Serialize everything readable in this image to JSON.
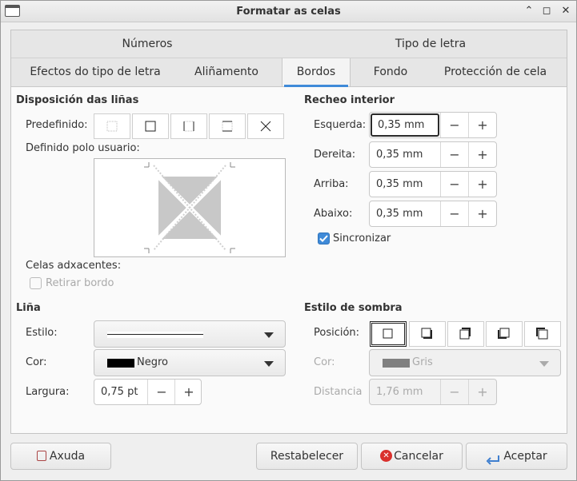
{
  "window": {
    "title": "Formatar as celas"
  },
  "tabs_row1": [
    "Números",
    "Tipo de letra"
  ],
  "tabs_row2": [
    "Efectos do tipo de letra",
    "Aliñamento",
    "Bordos",
    "Fondo",
    "Protección de cela"
  ],
  "active_tab": "Bordos",
  "line_arrangement": {
    "title": "Disposición das liñas",
    "preset_label": "Predefinido:",
    "user_defined_label": "Definido polo usuario:",
    "adjacent_label": "Celas adxacentes:",
    "remove_border_label": "Retirar bordo",
    "remove_border_checked": false
  },
  "padding": {
    "title": "Recheo interior",
    "left_label": "Esquerda:",
    "left_value": "0,35 mm",
    "right_label": "Dereita:",
    "right_value": "0,35 mm",
    "top_label": "Arriba:",
    "top_value": "0,35 mm",
    "bottom_label": "Abaixo:",
    "bottom_value": "0,35 mm",
    "sync_label": "Sincronizar",
    "sync_checked": true
  },
  "line": {
    "title": "Liña",
    "style_label": "Estilo:",
    "color_label": "Cor:",
    "color_value": "Negro",
    "color_swatch": "#000000",
    "width_label": "Largura:",
    "width_value": "0,75 pt"
  },
  "shadow": {
    "title": "Estilo de sombra",
    "position_label": "Posición:",
    "color_label": "Cor:",
    "color_value": "Gris",
    "color_swatch": "#808080",
    "distance_label": "Distancia",
    "distance_value": "1,76 mm"
  },
  "buttons": {
    "help": "Axuda",
    "reset": "Restabelecer",
    "cancel": "Cancelar",
    "ok": "Aceptar"
  },
  "spin_symbols": {
    "minus": "−",
    "plus": "+"
  },
  "titlebar_symbols": {
    "minimize": "⌃",
    "maximize": "◻",
    "close": "✕"
  },
  "colors": {
    "accent": "#3f8ad8",
    "cancel_red": "#d9302c"
  }
}
